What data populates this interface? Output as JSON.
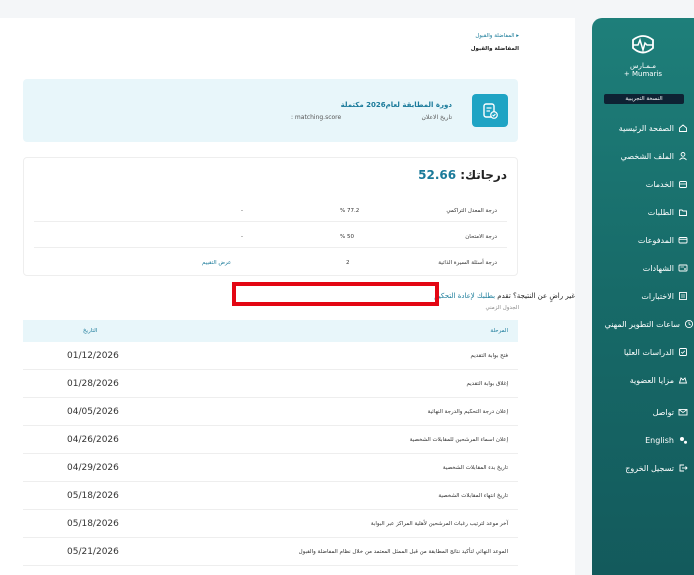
{
  "sidebar": {
    "logo_ar": "مـمـارس",
    "logo_en": "Mumaris +",
    "version": "النسخة التجريبية",
    "items": [
      {
        "label": "الصفحة الرئيسية",
        "icon": "home-icon"
      },
      {
        "label": "الملف الشخصي",
        "icon": "user-icon"
      },
      {
        "label": "الخدمات",
        "icon": "services-icon"
      },
      {
        "label": "الطلبات",
        "icon": "folder-icon"
      },
      {
        "label": "المدفوعات",
        "icon": "card-icon"
      },
      {
        "label": "الشهادات",
        "icon": "certificate-icon"
      },
      {
        "label": "الاختبارات",
        "icon": "exam-icon"
      },
      {
        "label": "ساعات التطوير المهني",
        "icon": "clock-icon"
      },
      {
        "label": "الدراسات العليا",
        "icon": "graduation-icon"
      },
      {
        "label": "مزايا العضوية",
        "icon": "membership-icon"
      }
    ],
    "bottom": [
      {
        "label": "تواصل",
        "icon": "mail-icon"
      },
      {
        "label": "English",
        "icon": "language-icon"
      },
      {
        "label": "تسجيل الخروج",
        "icon": "logout-icon"
      }
    ]
  },
  "breadcrumb": {
    "link": "المفاضلة والقبول",
    "current": "المفاضلة والقبول"
  },
  "course": {
    "title": "دورة المطابقة لعام2026 مكتملة",
    "date_label": "تاريخ الاعلان",
    "score_field": ": matching.score"
  },
  "score": {
    "label": "درجاتك:",
    "value": "52.66",
    "rows": [
      {
        "name": "درجة المعدل التراكمي",
        "pct": "% 77.2",
        "val": "-",
        "action": ""
      },
      {
        "name": "درجة الامتحان",
        "pct": "% 50",
        "val": "-",
        "action": ""
      },
      {
        "name": "درجة أسئلة السيرة الذاتية",
        "pct": "2",
        "val": "",
        "action": "عرض التقييم"
      }
    ]
  },
  "appeal": {
    "question": "غير راضٍ عن النتيجة؟ تقدم",
    "link": "بطلبك لإعادة التحكيم"
  },
  "schedule": {
    "caption": "الجدول الزمني",
    "col_stage": "المرحلة",
    "col_date": "التاريخ",
    "rows": [
      {
        "stage": "فتح بوابة التقديم",
        "date": "01/12/2026"
      },
      {
        "stage": "إغلاق بوابة التقديم",
        "date": "01/28/2026"
      },
      {
        "stage": "إعلان درجة التحكيم والدرجة النهائية",
        "date": "04/05/2026"
      },
      {
        "stage": "إعلان اسماء المرشحين للمقابلات الشخصية",
        "date": "04/26/2026"
      },
      {
        "stage": "تاريخ بدء المقابلات الشخصية",
        "date": "04/29/2026"
      },
      {
        "stage": "تاريخ انتهاء المقابلات الشخصية",
        "date": "05/18/2026"
      },
      {
        "stage": "آخر موعد لترتيب رغبات المرشحين لأهلية المراكز عبر البوابة",
        "date": "05/18/2026"
      },
      {
        "stage": "الموعد النهائي لتأكيد نتائج المطابقة من قبل الممثل المعتمد من خلال نظام المفاضلة والقبول",
        "date": "05/21/2026"
      }
    ]
  },
  "colors": {
    "accent": "#1a7a9a",
    "sidebar": "#176a68",
    "highlight": "#e30613"
  }
}
